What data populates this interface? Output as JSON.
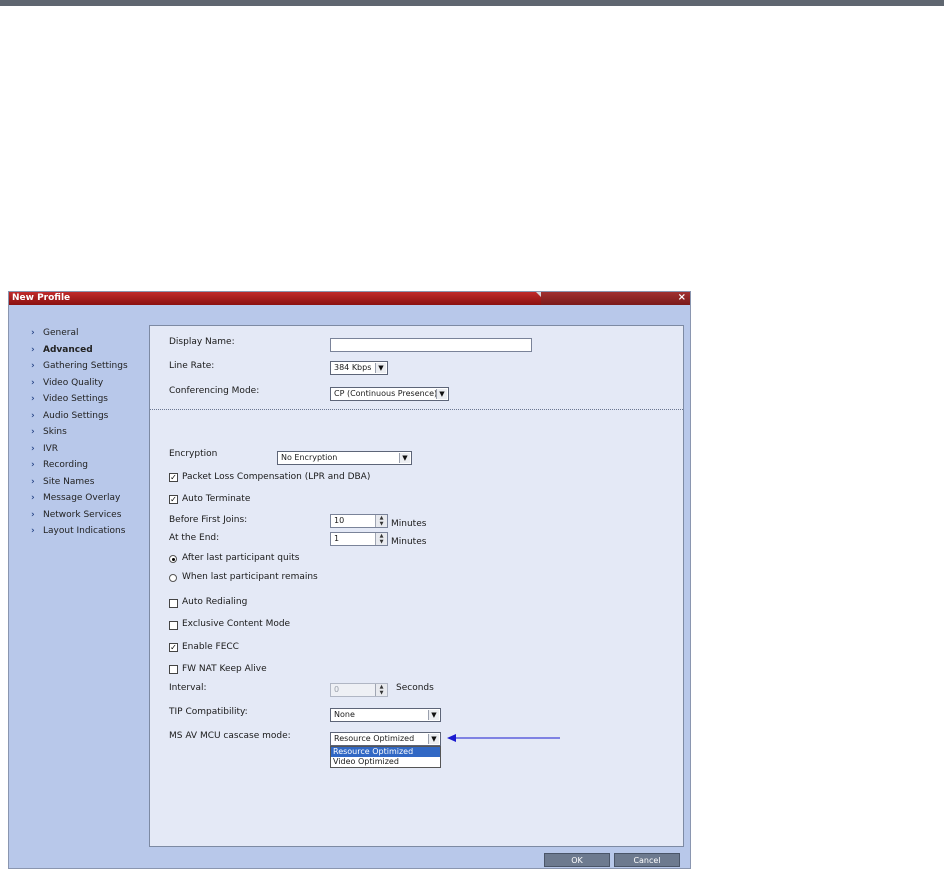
{
  "window": {
    "title": "New Profile",
    "close_glyph": "×"
  },
  "sidebar": {
    "items": [
      {
        "label": "General"
      },
      {
        "label": "Advanced"
      },
      {
        "label": "Gathering Settings"
      },
      {
        "label": "Video Quality"
      },
      {
        "label": "Video Settings"
      },
      {
        "label": "Audio Settings"
      },
      {
        "label": "Skins"
      },
      {
        "label": "IVR"
      },
      {
        "label": "Recording"
      },
      {
        "label": "Site Names"
      },
      {
        "label": "Message Overlay"
      },
      {
        "label": "Network Services"
      },
      {
        "label": "Layout Indications"
      }
    ],
    "active": "Advanced",
    "chevron": "›"
  },
  "form": {
    "display_name": {
      "label": "Display Name:",
      "value": ""
    },
    "line_rate": {
      "label": "Line Rate:",
      "value": "384 Kbps"
    },
    "conferencing_mode": {
      "label": "Conferencing Mode:",
      "value": "CP (Continuous Presence)"
    },
    "encryption": {
      "label": "Encryption",
      "value": "No Encryption"
    },
    "packet_loss": {
      "label": "Packet Loss Compensation (LPR and DBA)",
      "checked": true
    },
    "auto_terminate": {
      "label": "Auto Terminate",
      "checked": true
    },
    "before_first_joins": {
      "label": "Before First Joins:",
      "value": "10",
      "unit": "Minutes"
    },
    "at_the_end": {
      "label": "At the End:",
      "value": "1",
      "unit": "Minutes"
    },
    "after_last_quits": {
      "label": "After last participant quits",
      "selected": true
    },
    "when_last_remains": {
      "label": "When last participant remains",
      "selected": false
    },
    "auto_redialing": {
      "label": "Auto Redialing",
      "checked": false
    },
    "exclusive_content": {
      "label": "Exclusive Content Mode",
      "checked": false
    },
    "enable_fecc": {
      "label": "Enable FECC",
      "checked": true
    },
    "fw_nat": {
      "label": "FW NAT Keep Alive",
      "checked": false
    },
    "interval": {
      "label": "Interval:",
      "value": "0",
      "unit": "Seconds"
    },
    "tip": {
      "label": "TIP Compatibility:",
      "value": "None"
    },
    "ms_av": {
      "label": "MS AV MCU cascase mode:",
      "value": "Resource Optimized",
      "options": [
        "Resource Optimized",
        "Video Optimized"
      ]
    }
  },
  "footer": {
    "ok_label": "OK",
    "cancel_label": "Cancel"
  },
  "glyphs": {
    "check": "✓",
    "dropdown": "▼",
    "up": "▲",
    "down": "▼"
  },
  "colors": {
    "title_red": "#a81c1c",
    "annotation_arrow": "#1a1ad0",
    "highlight": "#3168c4"
  }
}
